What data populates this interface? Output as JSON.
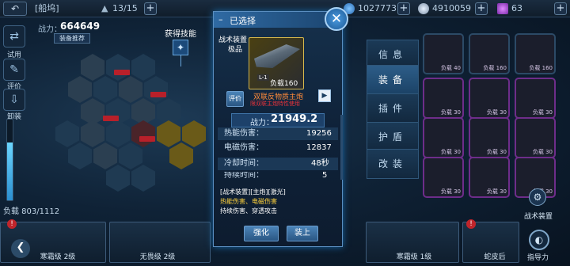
{
  "topbar": {
    "ship_name": "[船坞]",
    "ship_count": "13/15",
    "credits": "1027773",
    "crystals": "4910059",
    "gems": "63"
  },
  "left": {
    "power_label": "战力：",
    "power_value": "664649",
    "recommend_btn": "装备推荐",
    "try_label": "试用",
    "rate_label": "评价",
    "unload_label": "卸装",
    "load_text": "负载 803/1112",
    "load_fraction": 0.72,
    "skill_label": "获得技能"
  },
  "dialog": {
    "title": "已选择",
    "item_type": "战术装置",
    "item_quality": "极品",
    "item_load": "负载160",
    "item_level": "L-1",
    "review_btn": "评价",
    "item_name": "双联反物质主炮",
    "item_note": "限双联主炮特性使用",
    "power_label": "战力：",
    "power_value": "21949.2",
    "stats": [
      {
        "label": "热能伤害：",
        "value": "19256"
      },
      {
        "label": "电磁伤害：",
        "value": "12837"
      },
      {
        "label": "冷却时间：",
        "value": "48秒"
      },
      {
        "label": "持续时间：",
        "value": "5"
      }
    ],
    "tags": "[战术装置][主炮][激光]",
    "damage_types": "热能伤害、电磁伤害",
    "desc": "持续伤害、穿透攻击",
    "enhance_btn": "强化",
    "equip_btn": "装上"
  },
  "tabs": [
    "信息",
    "装备",
    "插件",
    "护盾",
    "改装"
  ],
  "slots": [
    {
      "lv": "负载 40"
    },
    {
      "lv": "负载 160"
    },
    {
      "lv": "负载 160"
    },
    {
      "lv": "负载 30"
    },
    {
      "lv": "负载 30"
    },
    {
      "lv": "负载 30"
    },
    {
      "lv": "负载 30"
    },
    {
      "lv": "负载 30"
    },
    {
      "lv": "负载 30"
    },
    {
      "lv": "负载 30"
    },
    {
      "lv": "负载 30"
    },
    {
      "lv": "负载 30"
    },
    {
      "lv": "负载 30"
    },
    {
      "lv": "负载 30"
    },
    {
      "lv": "负载 30"
    }
  ],
  "bottom": {
    "ships": [
      "寒霜级 2级",
      "无畏级 2级",
      "寒霜级 1级",
      "蛇皮后"
    ],
    "tactical_label": "战术装置",
    "guide_label": "指导力"
  },
  "colors": {
    "accent": "#3ea8ff",
    "purple_frame": "#6e2d8a",
    "alert": "#c0252b",
    "power": "#ffffff"
  }
}
